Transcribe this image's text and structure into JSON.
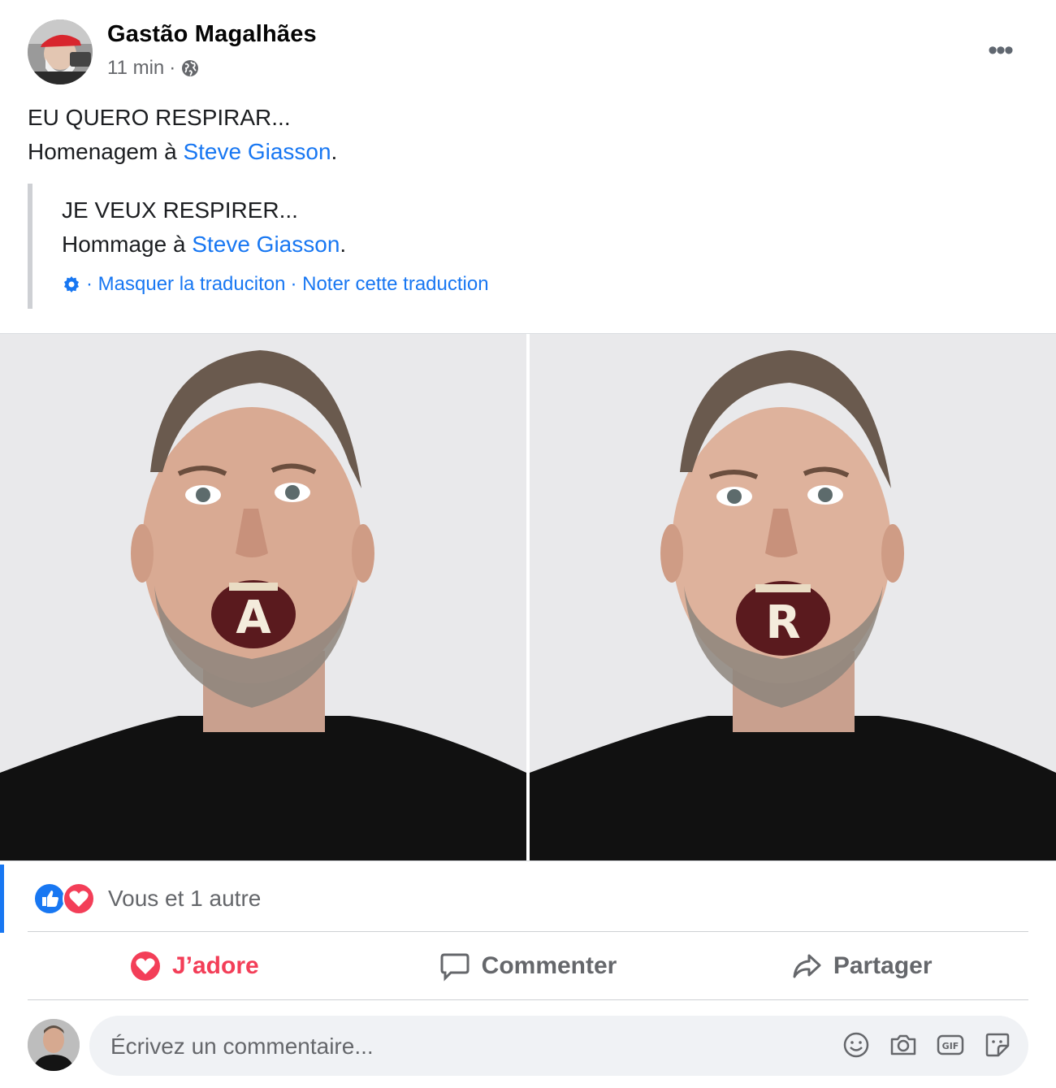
{
  "post": {
    "author": "Gastão Magalhães",
    "time": "11 min",
    "separator": "·",
    "privacy_icon": "globe-icon",
    "more_icon": "more-horizontal-icon",
    "more_label": "•••"
  },
  "message": {
    "line1": "EU QUERO  RESPIRAR...",
    "line2_prefix": "Homenagem à ",
    "mention": "Steve Giasson",
    "line2_suffix": "."
  },
  "translation": {
    "line1": "JE VEUX RESPIRER...",
    "line2_prefix": "Hommage à ",
    "mention": "Steve Giasson",
    "line2_suffix": ".",
    "settings_icon": "gear-icon",
    "hide_label": "· Masquer la traduciton",
    "rate_label": "· Noter cette traduction"
  },
  "photos": [
    {
      "letter": "A"
    },
    {
      "letter": "R"
    }
  ],
  "reactions": {
    "icons": [
      "like-icon",
      "love-icon"
    ],
    "summary": "Vous et 1 autre",
    "colors": {
      "like": "#1877f2",
      "love": "#f33e58"
    }
  },
  "actions": {
    "love_label": "J’adore",
    "comment_label": "Commenter",
    "share_label": "Partager"
  },
  "composer": {
    "placeholder": "Écrivez un commentaire...",
    "tools": [
      "emoji-icon",
      "camera-icon",
      "gif-icon",
      "sticker-icon"
    ],
    "gif_label": "GIF"
  },
  "colors": {
    "accent": "#1877f2",
    "love": "#f33e58",
    "secondary_text": "#65676b"
  }
}
